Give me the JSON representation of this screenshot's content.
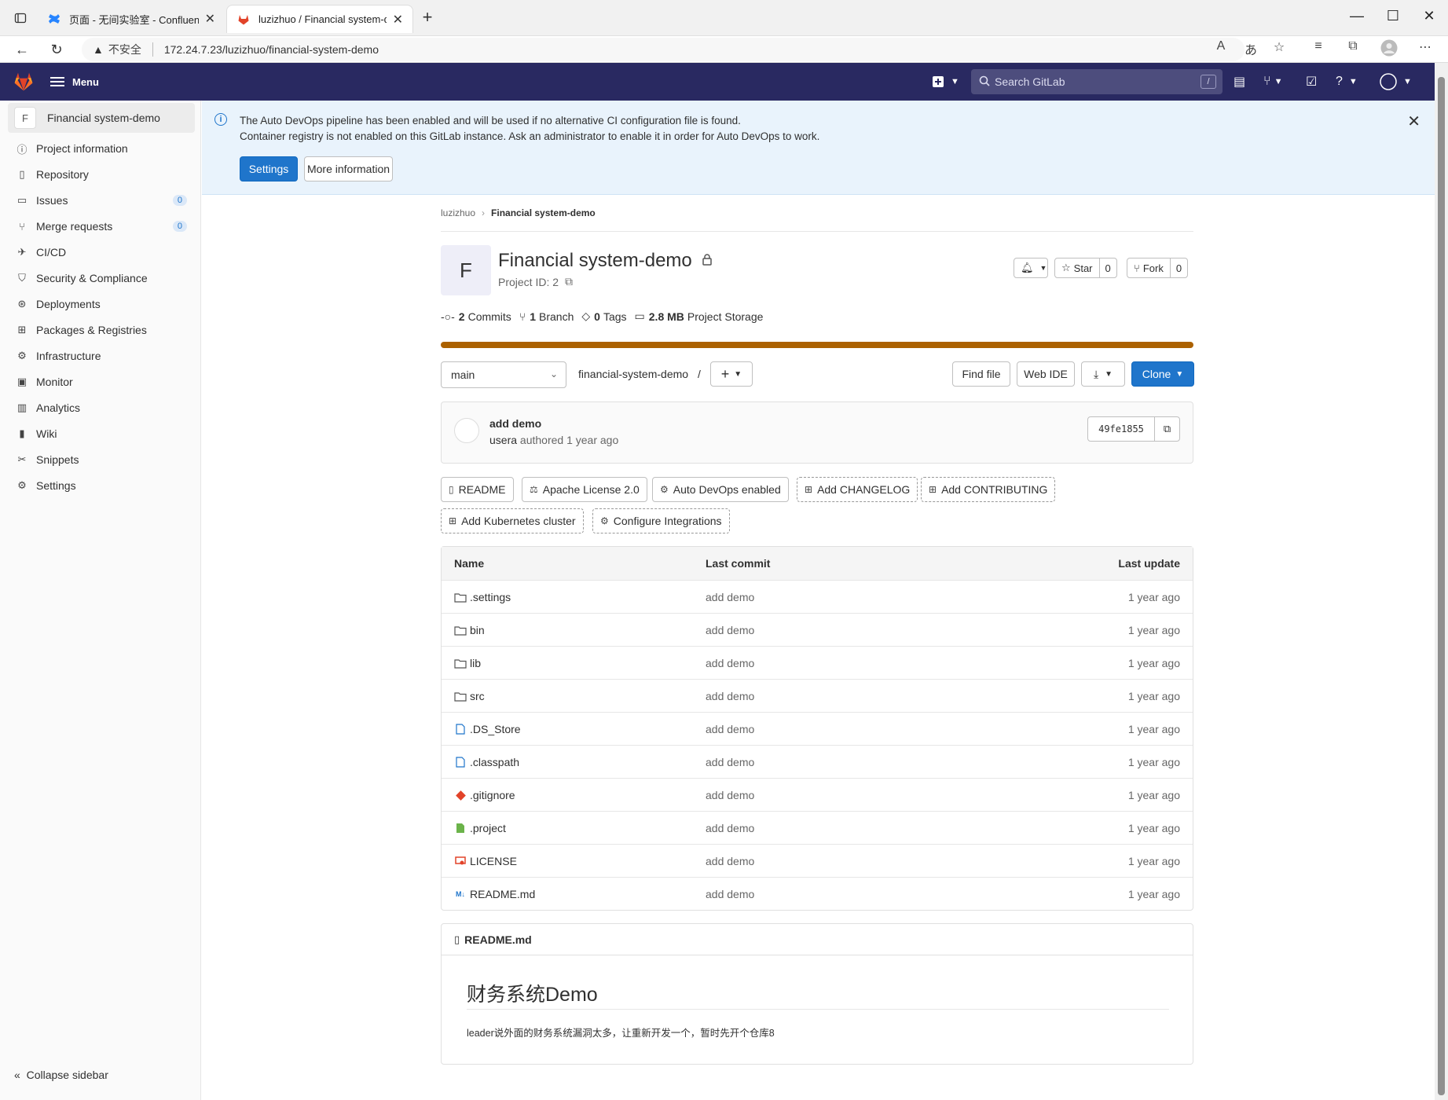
{
  "browser": {
    "tabs": [
      {
        "title": "页面 - 无间实验室 - Confluence"
      },
      {
        "title": "luzizhuo / Financial system-demo"
      }
    ],
    "insecure_label": "不安全",
    "url": "172.24.7.23/luzizhuo/financial-system-demo"
  },
  "topbar": {
    "menu_label": "Menu",
    "search_placeholder": "Search GitLab",
    "search_shortcut": "/"
  },
  "sidebar": {
    "project_initial": "F",
    "project_name": "Financial system-demo",
    "items": [
      {
        "label": "Project information",
        "icon": "info-doc-icon"
      },
      {
        "label": "Repository",
        "icon": "doc-icon"
      },
      {
        "label": "Issues",
        "icon": "issues-icon",
        "count": "0"
      },
      {
        "label": "Merge requests",
        "icon": "merge-icon",
        "count": "0"
      },
      {
        "label": "CI/CD",
        "icon": "rocket-icon"
      },
      {
        "label": "Security & Compliance",
        "icon": "shield-icon"
      },
      {
        "label": "Deployments",
        "icon": "deploy-icon"
      },
      {
        "label": "Packages & Registries",
        "icon": "package-icon"
      },
      {
        "label": "Infrastructure",
        "icon": "cloud-gear-icon"
      },
      {
        "label": "Monitor",
        "icon": "monitor-icon"
      },
      {
        "label": "Analytics",
        "icon": "chart-icon"
      },
      {
        "label": "Wiki",
        "icon": "book-icon"
      },
      {
        "label": "Snippets",
        "icon": "scissors-icon"
      },
      {
        "label": "Settings",
        "icon": "gear-icon"
      }
    ],
    "collapse_label": "Collapse sidebar"
  },
  "banner": {
    "line1": "The Auto DevOps pipeline has been enabled and will be used if no alternative CI configuration file is found.",
    "line2": "Container registry is not enabled on this GitLab instance. Ask an administrator to enable it in order for Auto DevOps to work.",
    "settings_label": "Settings",
    "more_info_label": "More information"
  },
  "breadcrumb": {
    "owner": "luzizhuo",
    "project": "Financial system-demo"
  },
  "project": {
    "initial": "F",
    "title": "Financial system-demo",
    "project_id": "Project ID: 2",
    "star_label": "Star",
    "star_count": "0",
    "fork_label": "Fork",
    "fork_count": "0",
    "stats": {
      "commits_num": "2",
      "commits_label": "Commits",
      "branch_num": "1",
      "branch_label": "Branch",
      "tags_num": "0",
      "tags_label": "Tags",
      "storage_num": "2.8 MB",
      "storage_label": "Project Storage"
    }
  },
  "repo_toolbar": {
    "branch": "main",
    "path": "financial-system-demo",
    "path_sep": "/",
    "find_file": "Find file",
    "web_ide": "Web IDE",
    "clone": "Clone"
  },
  "last_commit": {
    "message": "add demo",
    "author": "usera",
    "authored_text": "authored 1 year ago",
    "sha": "49fe1855"
  },
  "pills": {
    "readme": "README",
    "license": "Apache License 2.0",
    "autodevops": "Auto DevOps enabled",
    "changelog": "Add CHANGELOG",
    "contributing": "Add CONTRIBUTING",
    "kubernetes": "Add Kubernetes cluster",
    "integrations": "Configure Integrations"
  },
  "file_table": {
    "headers": {
      "name": "Name",
      "last_commit": "Last commit",
      "last_update": "Last update"
    },
    "rows": [
      {
        "name": ".settings",
        "commit": "add demo",
        "updated": "1 year ago",
        "type": "folder"
      },
      {
        "name": "bin",
        "commit": "add demo",
        "updated": "1 year ago",
        "type": "folder"
      },
      {
        "name": "lib",
        "commit": "add demo",
        "updated": "1 year ago",
        "type": "folder"
      },
      {
        "name": "src",
        "commit": "add demo",
        "updated": "1 year ago",
        "type": "folder"
      },
      {
        "name": ".DS_Store",
        "commit": "add demo",
        "updated": "1 year ago",
        "type": "file"
      },
      {
        "name": ".classpath",
        "commit": "add demo",
        "updated": "1 year ago",
        "type": "file"
      },
      {
        "name": ".gitignore",
        "commit": "add demo",
        "updated": "1 year ago",
        "type": "git"
      },
      {
        "name": ".project",
        "commit": "add demo",
        "updated": "1 year ago",
        "type": "project"
      },
      {
        "name": "LICENSE",
        "commit": "add demo",
        "updated": "1 year ago",
        "type": "license"
      },
      {
        "name": "README.md",
        "commit": "add demo",
        "updated": "1 year ago",
        "type": "markdown"
      }
    ]
  },
  "readme": {
    "filename": "README.md",
    "heading": "财务系统Demo",
    "body": "leader说外面的财务系统漏洞太多，让重新开发一个，暂时先开个仓库8"
  },
  "colors": {
    "topbar": "#292961",
    "primary": "#1f75cb",
    "banner_bg": "#e9f3fc",
    "progress": "#ab6100"
  }
}
